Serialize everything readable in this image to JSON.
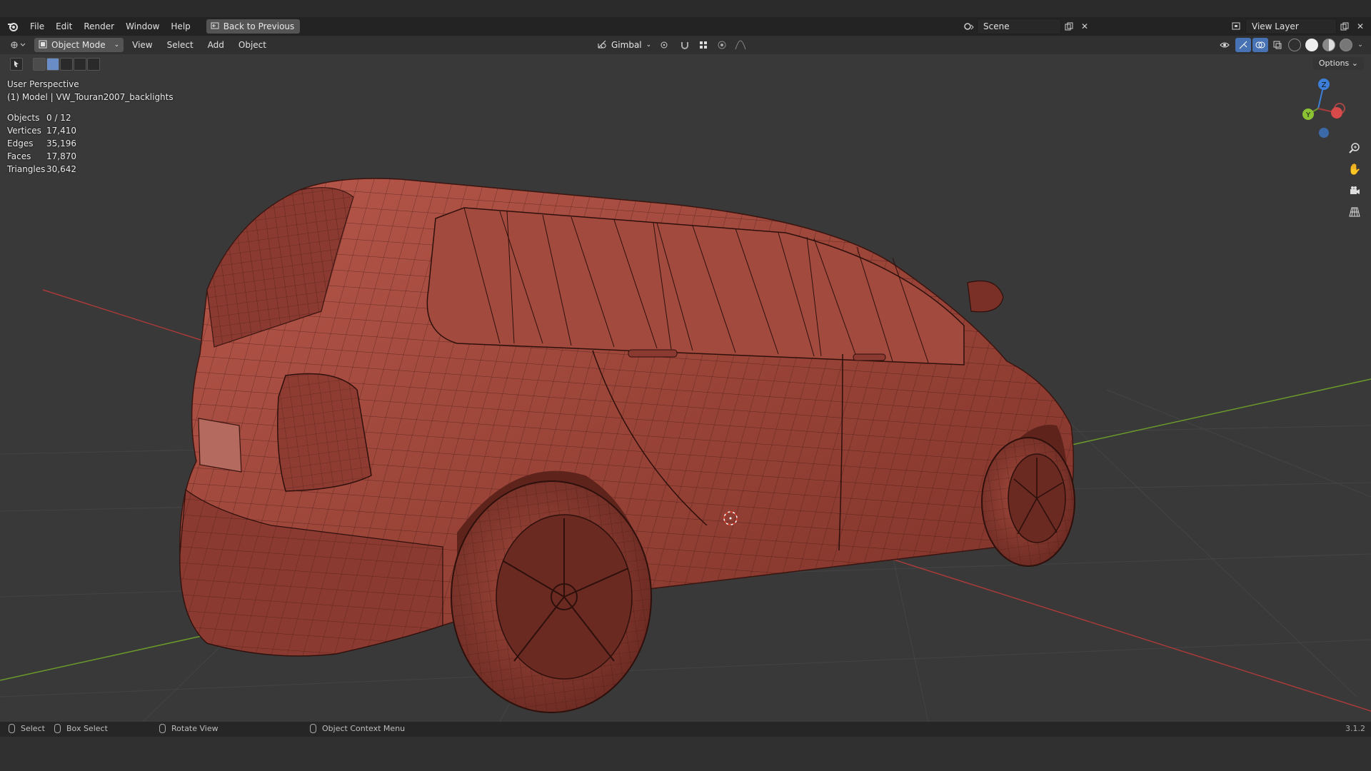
{
  "menubar": {
    "items": [
      "File",
      "Edit",
      "Render",
      "Window",
      "Help"
    ],
    "back_button": "Back to Previous",
    "scene_name": "Scene",
    "view_layer_name": "View Layer"
  },
  "header": {
    "mode": "Object Mode",
    "menus": [
      "View",
      "Select",
      "Add",
      "Object"
    ],
    "orientation": "Gimbal"
  },
  "toolbar": {
    "options_label": "Options"
  },
  "viewport": {
    "view_name": "User Perspective",
    "object_info": "(1) Model | VW_Touran2007_backlights",
    "stats": [
      {
        "label": "Objects",
        "value": "0 / 12"
      },
      {
        "label": "Vertices",
        "value": "17,410"
      },
      {
        "label": "Edges",
        "value": "35,196"
      },
      {
        "label": "Faces",
        "value": "17,870"
      },
      {
        "label": "Triangles",
        "value": "30,642"
      }
    ],
    "gizmo": {
      "z": "Z",
      "y": "Y"
    }
  },
  "statusbar": {
    "select": "Select",
    "box_select": "Box Select",
    "rotate_view": "Rotate View",
    "context_menu": "Object Context Menu",
    "version": "3.1.2"
  },
  "colors": {
    "mesh": "#9a4438",
    "wire": "#3a1510",
    "x_axis": "#a83a3a",
    "y_axis": "#6c9a2a",
    "z_axis": "#3d7fd8"
  }
}
